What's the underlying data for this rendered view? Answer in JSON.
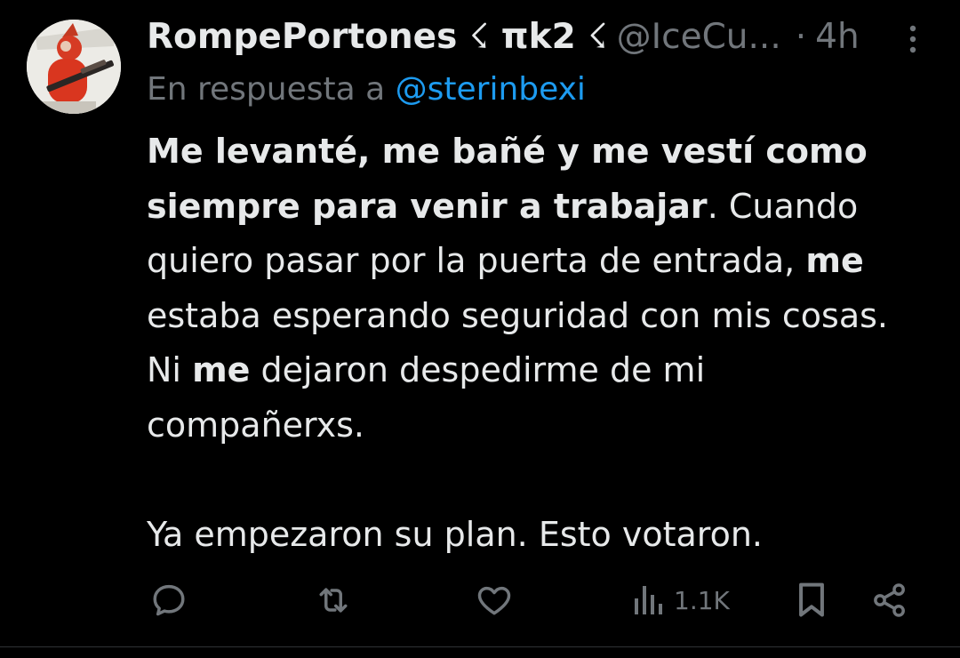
{
  "author": {
    "display_name": "RompePortones ☇ πk2 ☇",
    "handle": "@IceCu...",
    "dot": "·",
    "time": "4h"
  },
  "reply": {
    "prefix": "En respuesta a ",
    "mention": "@sterinbexi"
  },
  "tweet": {
    "p1_bold": "Me levanté, me bañé y me vestí como siempre para venir a trabajar",
    "p1_rest": ". Cuando quiero pasar por la puerta de entrada, ",
    "p1_bold2": "me",
    "p1_rest2": " estaba esperando seguridad con mis cosas. Ni ",
    "p1_bold3": "me",
    "p1_rest3": " dejaron despedirme de mi compañerxs.",
    "p2": "Ya empezaron su plan. Esto votaron."
  },
  "actions": {
    "reply_icon": "reply-icon",
    "retweet_icon": "retweet-icon",
    "like_icon": "heart-icon",
    "views_icon": "views-icon",
    "views_count": "1.1K",
    "bookmark_icon": "bookmark-icon",
    "share_icon": "share-icon"
  },
  "colors": {
    "background": "#000000",
    "text": "#e7e9ea",
    "secondary": "#71767b",
    "accent": "#1d9bf0"
  }
}
